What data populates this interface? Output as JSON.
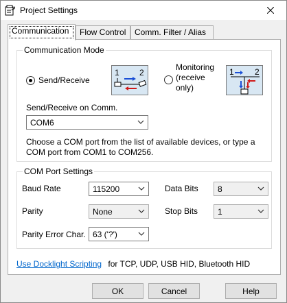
{
  "window": {
    "title": "Project Settings"
  },
  "tabs": [
    {
      "label": "Communication"
    },
    {
      "label": "Flow Control"
    },
    {
      "label": "Comm. Filter / Alias"
    }
  ],
  "comm_mode": {
    "legend": "Communication Mode",
    "send_receive": {
      "label": "Send/Receive",
      "checked": true
    },
    "monitoring": {
      "label_line1": "Monitoring",
      "label_line2": "(receive",
      "label_line3": "only)",
      "checked": false
    },
    "diagram_numbers": {
      "one": "1",
      "two": "2"
    }
  },
  "send_receive_on": {
    "label": "Send/Receive on Comm.",
    "value": "COM6",
    "help_line1": "Choose a COM port from the list of available devices, or type a",
    "help_line2": "COM port from COM1 to COM256."
  },
  "com_port_settings": {
    "legend": "COM Port Settings",
    "baud_rate": {
      "label": "Baud Rate",
      "value": "115200"
    },
    "parity": {
      "label": "Parity",
      "value": "None"
    },
    "parity_error_char": {
      "label": "Parity Error Char.",
      "value": "63 ('?')"
    },
    "data_bits": {
      "label": "Data Bits",
      "value": "8"
    },
    "stop_bits": {
      "label": "Stop Bits",
      "value": "1"
    }
  },
  "footer_link": {
    "link_text": "Use Docklight Scripting",
    "suffix": "for TCP, UDP, USB HID, Bluetooth HID"
  },
  "buttons": {
    "ok": "OK",
    "cancel": "Cancel",
    "help": "Help"
  },
  "colors": {
    "accent_blue": "#0066cc",
    "arrow_blue": "#1a4fd6",
    "arrow_red": "#d01818",
    "diagram_bg": "#d8e7f3"
  }
}
